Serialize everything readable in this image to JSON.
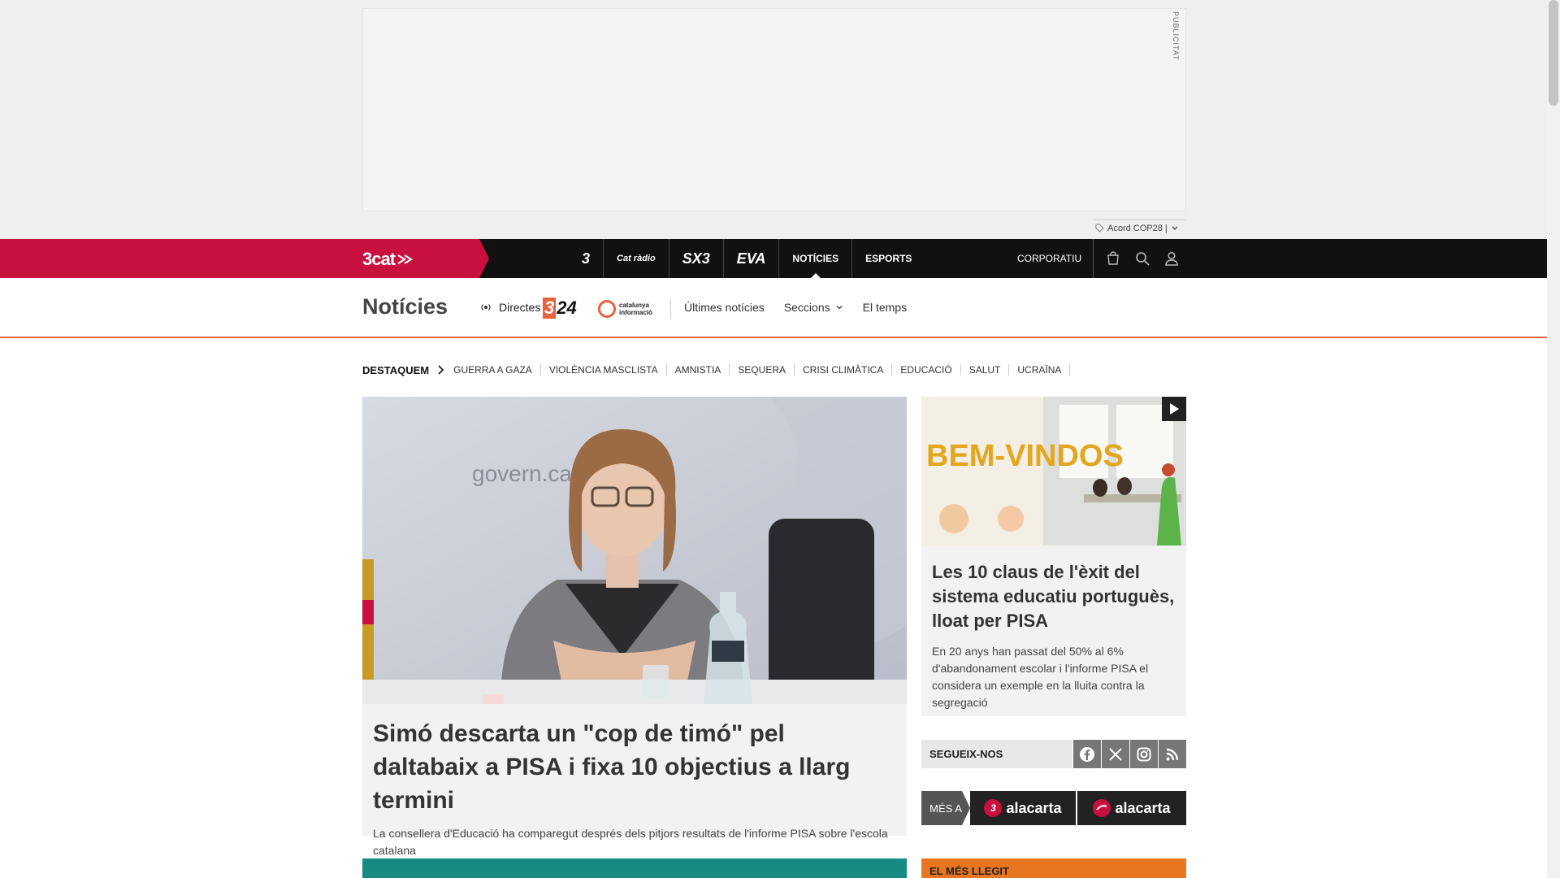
{
  "ad": {
    "label": "PUBLICITAT",
    "tag_label": "Acord COP28 |"
  },
  "topbar": {
    "brand": "3cat",
    "channels": [
      {
        "label": "3"
      },
      {
        "label": "Cat ràdio"
      },
      {
        "label": "SX3"
      },
      {
        "label": "EVA"
      },
      {
        "label": "NOTÍCIES"
      },
      {
        "label": "ESPORTS"
      }
    ],
    "corporatiu": "CORPORATIU"
  },
  "section": {
    "title": "Notícies",
    "directes": "Directes",
    "logo_324_a": "3",
    "logo_324_b": "24",
    "logo_cat_1": "catalunya",
    "logo_cat_2": "informació",
    "nav": [
      "Últimes notícies",
      "Seccions",
      "El temps"
    ]
  },
  "highlights": {
    "title": "DESTAQUEM",
    "items": [
      "GUERRA A GAZA",
      "VIOLÈNCIA MASCLISTA",
      "AMNISTIA",
      "SEQUERA",
      "CRISI CLIMÀTICA",
      "EDUCACIÓ",
      "SALUT",
      "UCRAÏNA"
    ]
  },
  "main_story": {
    "image_text": "govern.cat",
    "title": "Simó descarta un \"cop de timó\" pel daltabaix a PISA i fixa 10 objectius a llarg termini",
    "summary": "La consellera d'Educació ha comparegut després dels pitjors resultats de l'informe PISA sobre l'escola catalana"
  },
  "side_story": {
    "image_text": "BEM-VINDOS",
    "title": "Les 10 claus de l'èxit del sistema educatiu portuguès, lloat per PISA",
    "summary": "En 20 anys han passat del 50% al 6% d'abandonament escolar i l'informe PISA el considera un exemple en la lluita contra la segregació"
  },
  "follow": {
    "label": "SEGUEIX-NOS"
  },
  "mesa": {
    "label": "MÉS A",
    "alacarta_1": "alacarta",
    "alacarta_2": "alacarta",
    "badge_1": "3"
  },
  "mes_llegit": {
    "label": "EL MÉS LLEGIT"
  },
  "colors": {
    "brand": "#c8103e",
    "accent": "#e8623e",
    "teal": "#178a82"
  }
}
